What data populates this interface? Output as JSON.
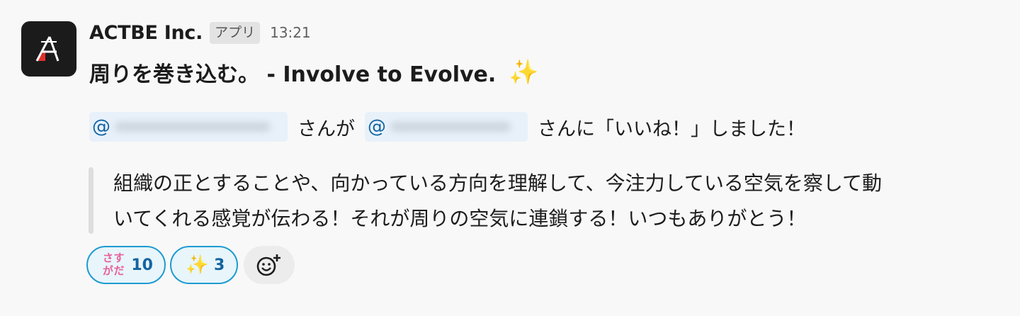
{
  "message": {
    "sender": "ACTBE Inc.",
    "app_badge": "アプリ",
    "timestamp": "13:21",
    "avatar_logo_text": "ACTBE Inc.",
    "title": "周りを巻き込む。 - Involve to Evolve.",
    "title_emoji": "sparkles",
    "mention_line": {
      "mention_1_prefix": "@",
      "middle_text": "さんが",
      "mention_2_prefix": "@",
      "suffix_text": "さんに「いいね！」しました！"
    },
    "quote_lines": [
      "組織の正とすることや、向かっている方向を理解して、今注力している空気を察して動",
      "いてくれる感覚が伝わる！それが周りの空気に連鎖する！いつもありがとう！"
    ]
  },
  "reactions": [
    {
      "emoji": "sasuga",
      "emoji_chars": [
        "さ",
        "す",
        "が",
        "だ"
      ],
      "count": "10"
    },
    {
      "emoji": "sparkles",
      "emoji_char": "✨",
      "count": "3"
    }
  ],
  "add_reaction_icon": "add-reaction-icon",
  "colors": {
    "mention_bg": "#e8f1fa",
    "mention_text": "#1264a3",
    "reaction_border": "#1d9bd1",
    "reaction_bg": "#e8f5fa",
    "sasuga_pink": "#e8609a",
    "sparkle_yellow": "#f1c232"
  }
}
